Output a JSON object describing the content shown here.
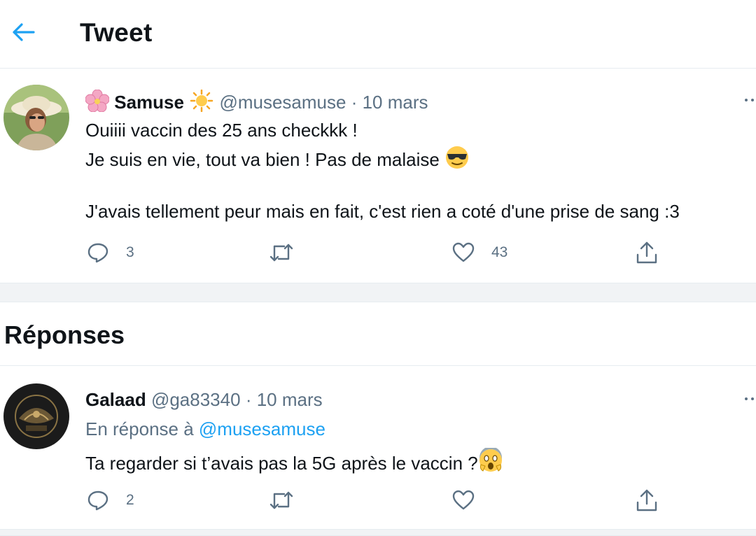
{
  "header": {
    "title": "Tweet",
    "back_icon": "arrow-left-icon"
  },
  "main_tweet": {
    "display_name": "Samuse",
    "handle": "@musesamuse",
    "separator": "·",
    "date": "10 mars",
    "lines": [
      "Ouiiii vaccin des 25 ans checkkk !",
      "Je suis en vie, tout va bien ! Pas de malaise",
      "J'avais tellement peur mais en fait, c'est rien a coté d'une prise de sang :3"
    ],
    "actions": {
      "replies": "3",
      "retweets": "",
      "likes": "43"
    }
  },
  "replies_section": {
    "title": "Réponses"
  },
  "reply": {
    "display_name": "Galaad",
    "handle": "@ga83340",
    "separator": "·",
    "date": "10 mars",
    "in_reply_prefix": "En réponse à",
    "in_reply_handle": "@musesamuse",
    "text": "Ta regarder si t’avais pas la 5G après le vaccin ?",
    "actions": {
      "replies": "2",
      "retweets": "",
      "likes": ""
    }
  },
  "colors": {
    "accent": "#1da1f2",
    "muted": "#5b7083",
    "text": "#0f1419",
    "border": "#e6ecf0"
  }
}
